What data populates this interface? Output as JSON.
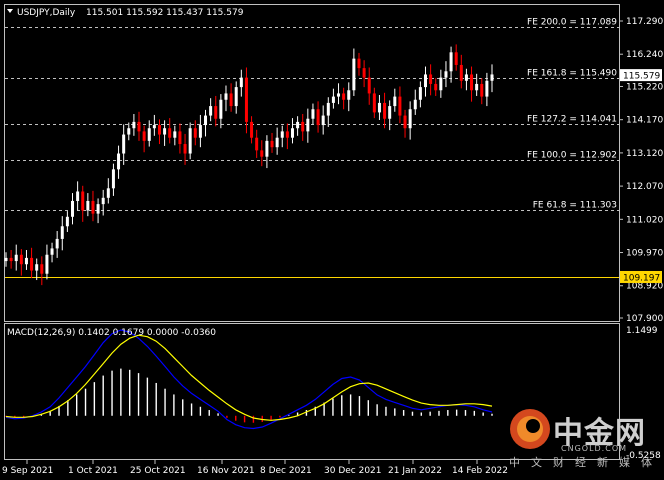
{
  "header": {
    "symbol_label": "USDJPY,Daily",
    "ohlc": "115.501 115.592 115.437 115.579",
    "menu_icon": "triangle-down-icon"
  },
  "colors": {
    "background": "#000000",
    "bull": "#ffffff",
    "bear": "#ff0000",
    "macd_line": "#0000ff",
    "signal_line": "#ffff00",
    "hist_pos": "#ffffff",
    "hist_neg": "#ff0000",
    "grid": "#c0c0c0",
    "support_line": "#ffd700"
  },
  "price_axis": {
    "ticks": [
      "117.290",
      "116.240",
      "115.220",
      "114.170",
      "113.120",
      "112.070",
      "111.020",
      "109.970",
      "108.920",
      "107.900"
    ],
    "current_price": "115.579",
    "support_price": "109.197"
  },
  "fib_levels": [
    {
      "label": "FE 200.0 = 117.089",
      "value": 117.089
    },
    {
      "label": "FE 161.8 = 115.490",
      "value": 115.49
    },
    {
      "label": "FE 127.2 = 114.041",
      "value": 114.041
    },
    {
      "label": "FE 100.0 = 112.902",
      "value": 112.902
    },
    {
      "label": "FE 61.8 = 111.303",
      "value": 111.303
    }
  ],
  "date_axis": [
    "9 Sep 2021",
    "1 Oct 2021",
    "25 Oct 2021",
    "16 Nov 2021",
    "8 Dec 2021",
    "30 Dec 2021",
    "21 Jan 2022",
    "14 Feb 2022"
  ],
  "macd": {
    "label": "MACD(12,26,9) 0.1402 0.1679 0.0000 -0.0360",
    "axis_top": "1.1499",
    "axis_bottom": "-0.5258"
  },
  "watermark": {
    "brand_cn": "中金网",
    "url": "CNGOLD.COM",
    "slogan": "中文财经新媒体"
  },
  "chart_data": {
    "type": "candlestick",
    "title": "USDJPY,Daily",
    "ylim": [
      107.5,
      117.7
    ],
    "x": [
      "9 Sep 2021",
      "1 Oct 2021",
      "25 Oct 2021",
      "16 Nov 2021",
      "8 Dec 2021",
      "30 Dec 2021",
      "21 Jan 2022",
      "14 Feb 2022"
    ],
    "close_series": [
      109.8,
      109.7,
      109.9,
      109.6,
      109.8,
      109.4,
      109.6,
      109.3,
      109.9,
      110.1,
      110.4,
      110.8,
      111.1,
      111.6,
      111.9,
      111.3,
      111.6,
      111.2,
      111.5,
      111.7,
      112.0,
      112.6,
      113.1,
      113.7,
      113.9,
      114.1,
      113.8,
      113.5,
      113.9,
      114.0,
      113.7,
      113.9,
      113.6,
      113.8,
      113.4,
      113.1,
      113.9,
      113.6,
      114.0,
      114.3,
      114.6,
      114.2,
      114.8,
      115.0,
      114.6,
      115.2,
      115.5,
      114.1,
      113.6,
      113.2,
      113.0,
      113.5,
      113.3,
      113.6,
      113.8,
      113.6,
      113.9,
      114.1,
      113.8,
      114.2,
      114.5,
      114.0,
      114.3,
      114.7,
      114.9,
      115.0,
      114.8,
      115.1,
      116.1,
      115.8,
      115.5,
      115.0,
      114.4,
      114.7,
      114.2,
      114.6,
      114.9,
      114.3,
      113.9,
      114.5,
      114.8,
      115.2,
      115.6,
      115.3,
      115.1,
      115.5,
      115.7,
      116.3,
      115.9,
      115.4,
      115.6,
      115.1,
      115.3,
      114.9,
      115.4,
      115.6
    ],
    "macd_series": [
      -0.02,
      -0.04,
      -0.03,
      0.0,
      0.05,
      0.12,
      0.24,
      0.38,
      0.52,
      0.66,
      0.82,
      0.98,
      1.1,
      1.15,
      1.12,
      1.04,
      0.93,
      0.8,
      0.66,
      0.52,
      0.4,
      0.3,
      0.22,
      0.14,
      0.06,
      -0.05,
      -0.12,
      -0.16,
      -0.17,
      -0.15,
      -0.1,
      -0.04,
      0.02,
      0.08,
      0.14,
      0.22,
      0.32,
      0.42,
      0.5,
      0.52,
      0.48,
      0.38,
      0.28,
      0.22,
      0.18,
      0.14,
      0.1,
      0.08,
      0.1,
      0.12,
      0.14,
      0.15,
      0.14,
      0.12,
      0.08,
      0.05
    ],
    "signal_series": [
      -0.01,
      -0.02,
      -0.02,
      -0.01,
      0.02,
      0.06,
      0.12,
      0.2,
      0.3,
      0.42,
      0.56,
      0.7,
      0.84,
      0.96,
      1.04,
      1.08,
      1.06,
      1.0,
      0.9,
      0.78,
      0.66,
      0.54,
      0.44,
      0.34,
      0.25,
      0.16,
      0.08,
      0.02,
      -0.03,
      -0.05,
      -0.06,
      -0.05,
      -0.03,
      0.0,
      0.05,
      0.1,
      0.16,
      0.24,
      0.32,
      0.39,
      0.43,
      0.44,
      0.41,
      0.36,
      0.31,
      0.26,
      0.21,
      0.17,
      0.15,
      0.14,
      0.14,
      0.15,
      0.16,
      0.16,
      0.15,
      0.13
    ]
  }
}
